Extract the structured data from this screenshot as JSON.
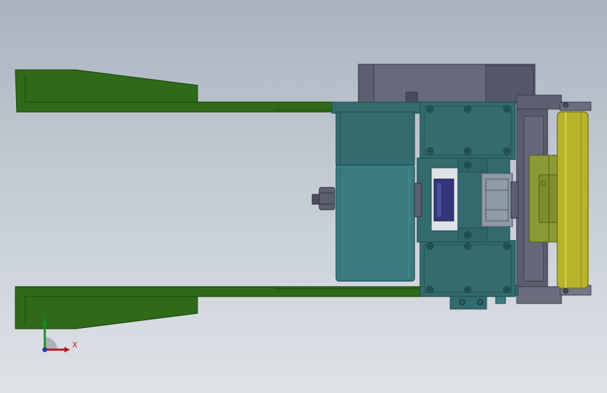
{
  "viewport": {
    "background_top": "#a9b2be",
    "background_bottom": "#dfe3e8"
  },
  "colors": {
    "fork_green": "#2f6a18",
    "fork_green_dark": "#1c4a0c",
    "teal": "#336b6f",
    "teal_dark": "#1f4f52",
    "motor_teal": "#3a7c80",
    "housing_gray": "#5c5f70",
    "housing_dark": "#3b3e4a",
    "roller_yellow": "#b6b42a",
    "bracket_olive": "#8c9a36",
    "pad_blue": "#33367a",
    "axis_x": "#b01c1c",
    "axis_y": "#1c8a2a",
    "axis_z": "#2438a8"
  },
  "triad": {
    "x_label": "X",
    "y_label": "Y",
    "icon": "coordinate-triad-icon"
  }
}
